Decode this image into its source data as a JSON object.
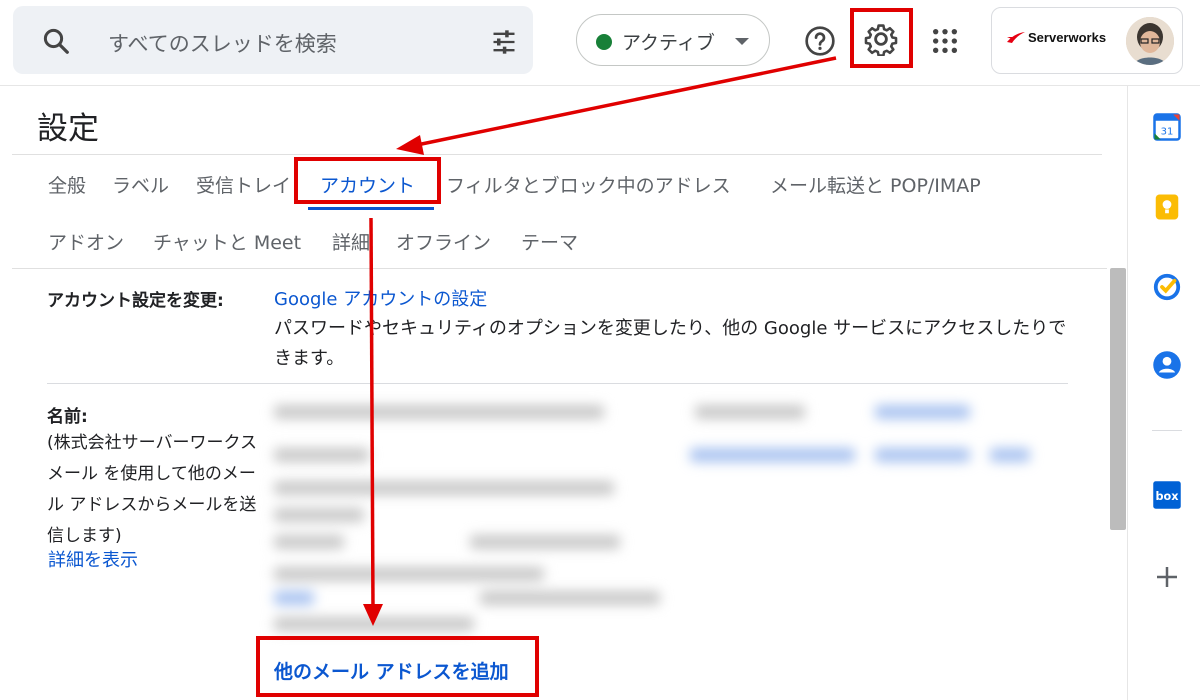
{
  "search": {
    "placeholder": "すべてのスレッドを検索"
  },
  "status": {
    "label": "アクティブ",
    "color": "#188038"
  },
  "account": {
    "brand": "Serverworks"
  },
  "settings": {
    "title": "設定",
    "tabs_row1": [
      "全般",
      "ラベル",
      "受信トレイ",
      "アカウント",
      "フィルタとブロック中のアドレス",
      "メール転送と POP/IMAP"
    ],
    "tabs_row2": [
      "アドオン",
      "チャットと Meet",
      "詳細",
      "オフライン",
      "テーマ"
    ],
    "active_tab": "アカウント"
  },
  "account_section": {
    "label": "アカウント設定を変更:",
    "link": "Google アカウントの設定",
    "description": "パスワードやセキュリティのオプションを変更したり、他の Google サービスにアクセスしたりできます。"
  },
  "name_section": {
    "label": "名前:",
    "sub": "(株式会社サーバーワークス メール を使用して他のメール アドレスからメールを送信します)",
    "details_link": "詳細を表示",
    "add_link": "他のメール アドレスを追加"
  },
  "side_apps": [
    "calendar-icon",
    "keep-icon",
    "tasks-icon",
    "contacts-icon",
    "box-icon",
    "add-icon"
  ],
  "colors": {
    "accent": "#0b57d0",
    "highlight": "#e00000"
  }
}
